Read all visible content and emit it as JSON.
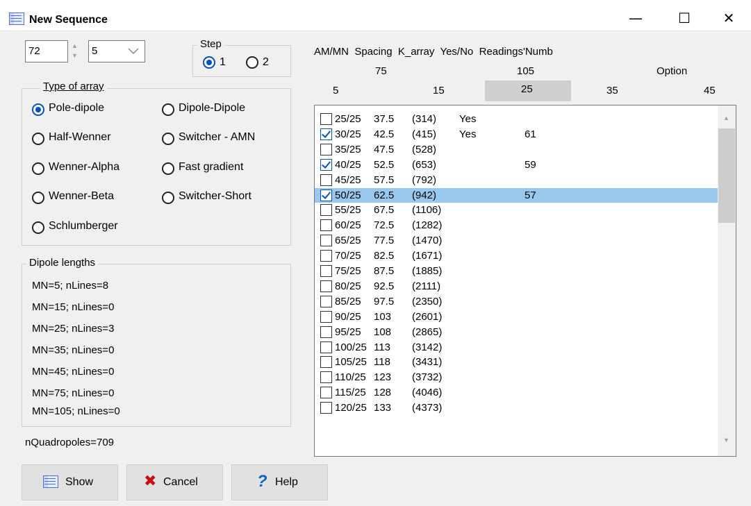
{
  "window": {
    "title": "New Sequence",
    "minimize": "—",
    "maximize": "☐",
    "close": "✕"
  },
  "top_controls": {
    "value1": "72",
    "value2": "5",
    "step_label": "Step",
    "step_options": [
      "1",
      "2"
    ]
  },
  "array_group": {
    "label": "Type of array",
    "options": [
      "Pole-dipole",
      "Dipole-Dipole",
      "Half-Wenner",
      "Switcher - AMN",
      "Wenner-Alpha",
      "Fast gradient",
      "Wenner-Beta",
      "Switcher-Short",
      "Schlumberger"
    ],
    "selected": "Pole-dipole"
  },
  "dipole_group": {
    "label": "Dipole lengths",
    "lines": [
      "MN=5; nLines=8",
      "MN=15; nLines=0",
      "MN=25; nLines=3",
      "MN=35; nLines=0",
      "MN=45; nLines=0",
      "MN=75; nLines=0",
      "MN=105; nLines=0"
    ]
  },
  "quadropoles": "nQuadropoles=709",
  "list_header": {
    "columns": "AM/MN  Spacing  K_array  Yes/No  Readings'Numb",
    "row1": [
      "75",
      "105",
      "Option"
    ],
    "row2": [
      "5",
      "15",
      "25",
      "35",
      "45"
    ],
    "selected_tab": "25"
  },
  "rows": [
    {
      "checked": false,
      "amn": "25/25",
      "spacing": "37.5",
      "k": "(314)",
      "yn": "Yes",
      "readings": ""
    },
    {
      "checked": true,
      "amn": "30/25",
      "spacing": "42.5",
      "k": "(415)",
      "yn": "Yes",
      "readings": "61"
    },
    {
      "checked": false,
      "amn": "35/25",
      "spacing": "47.5",
      "k": "(528)",
      "yn": "",
      "readings": ""
    },
    {
      "checked": true,
      "amn": "40/25",
      "spacing": "52.5",
      "k": "(653)",
      "yn": "",
      "readings": "59"
    },
    {
      "checked": false,
      "amn": "45/25",
      "spacing": "57.5",
      "k": "(792)",
      "yn": "",
      "readings": ""
    },
    {
      "checked": true,
      "amn": "50/25",
      "spacing": "62.5",
      "k": "(942)",
      "yn": "",
      "readings": "57",
      "selected": true
    },
    {
      "checked": false,
      "amn": "55/25",
      "spacing": "67.5",
      "k": "(1106)",
      "yn": "",
      "readings": ""
    },
    {
      "checked": false,
      "amn": "60/25",
      "spacing": "72.5",
      "k": "(1282)",
      "yn": "",
      "readings": ""
    },
    {
      "checked": false,
      "amn": "65/25",
      "spacing": "77.5",
      "k": "(1470)",
      "yn": "",
      "readings": ""
    },
    {
      "checked": false,
      "amn": "70/25",
      "spacing": "82.5",
      "k": "(1671)",
      "yn": "",
      "readings": ""
    },
    {
      "checked": false,
      "amn": "75/25",
      "spacing": "87.5",
      "k": "(1885)",
      "yn": "",
      "readings": ""
    },
    {
      "checked": false,
      "amn": "80/25",
      "spacing": "92.5",
      "k": "(2111)",
      "yn": "",
      "readings": ""
    },
    {
      "checked": false,
      "amn": "85/25",
      "spacing": "97.5",
      "k": "(2350)",
      "yn": "",
      "readings": ""
    },
    {
      "checked": false,
      "amn": "90/25",
      "spacing": "103",
      "k": "(2601)",
      "yn": "",
      "readings": ""
    },
    {
      "checked": false,
      "amn": "95/25",
      "spacing": "108",
      "k": "(2865)",
      "yn": "",
      "readings": ""
    },
    {
      "checked": false,
      "amn": "100/25",
      "spacing": "113",
      "k": "(3142)",
      "yn": "",
      "readings": ""
    },
    {
      "checked": false,
      "amn": "105/25",
      "spacing": "118",
      "k": "(3431)",
      "yn": "",
      "readings": ""
    },
    {
      "checked": false,
      "amn": "110/25",
      "spacing": "123",
      "k": "(3732)",
      "yn": "",
      "readings": ""
    },
    {
      "checked": false,
      "amn": "115/25",
      "spacing": "128",
      "k": "(4046)",
      "yn": "",
      "readings": ""
    },
    {
      "checked": false,
      "amn": "120/25",
      "spacing": "133",
      "k": "(4373)",
      "yn": "",
      "readings": ""
    }
  ],
  "buttons": {
    "show": "Show",
    "cancel": "Cancel",
    "help": "Help"
  }
}
